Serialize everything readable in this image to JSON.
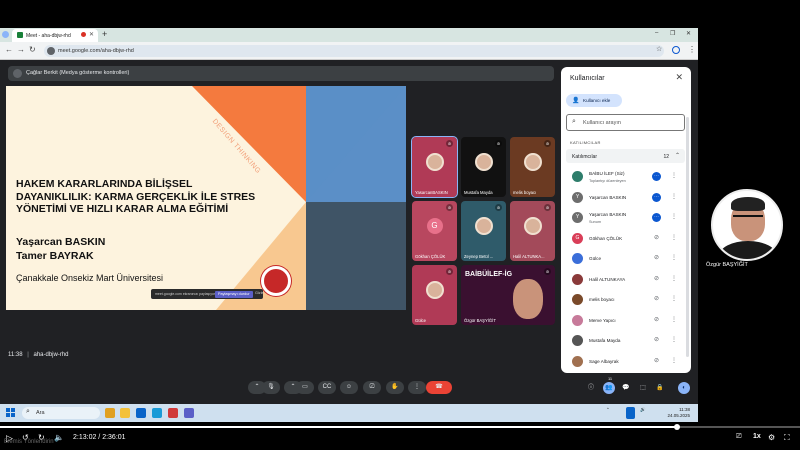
{
  "browser": {
    "tab_title": "Meet - aha-dbjw-rhd",
    "url": "meet.google.com/aha-dbjw-rhd",
    "new_tab_label": "+"
  },
  "meet": {
    "presenter_notice": "Çağlar Berkit (Medya gösterme kontrolleri)",
    "meeting_time": "11:38",
    "meeting_code": "aha-dbjw-rhd",
    "raise_count": "11"
  },
  "slide": {
    "title_lines": [
      "HAKEM KARARLARINDA BİLİŞSEL",
      "DAYANIKLILIK: KARMA GERÇEKLİK İLE STRES",
      "YÖNETİMİ VE HIZLI KARAR ALMA EĞİTİMİ"
    ],
    "author1": "Yaşarcan BASKIN",
    "author2": "Tamer BAYRAK",
    "university": "Çanakkale Onsekiz Mart Üniversitesi",
    "side_text": "DESIGN THINKING",
    "share_text": "meet.google.com ekranınızı paylaşıyor.",
    "share_stop": "Paylaşmayı durdur",
    "share_hide": "Gizle",
    "colors": {
      "bg": "#fdf3de",
      "orange": "#f47a3e",
      "blue": "#5b8fc7",
      "navy": "#3f5466",
      "peach": "#f8c890"
    }
  },
  "tiles": [
    {
      "name": "YasarcanBASKIN",
      "avatar": "",
      "bg": "#b03a56"
    },
    {
      "name": "Mustafa Mayda",
      "avatar": "",
      "bg": "#111111"
    },
    {
      "name": "melis boyacı",
      "avatar": "",
      "bg": "#6b3a22"
    },
    {
      "name": "Gökhan ÇÖLÜK",
      "avatar": "G",
      "bg": "#b8475f"
    },
    {
      "name": "Zeynep Betül ...",
      "avatar": "",
      "bg": "#2f5b6a"
    },
    {
      "name": "Halil ALTUNKA...",
      "avatar": "",
      "bg": "#a34a5a"
    },
    {
      "name": "Gülce",
      "avatar": "",
      "bg": "#b03a56"
    },
    {
      "name": "Özgür BAŞYİĞİT",
      "avatar": "",
      "bg": "#3a1030",
      "brand": "BAİBÜİLEF-İG"
    }
  ],
  "panel": {
    "title": "Kullanıcılar",
    "add_button": "Kullanıcı ekle",
    "search_placeholder": "Kullanıcı arayın",
    "section": "KATILIMCILAR",
    "group": "Katılımcılar",
    "group_count": "12",
    "people": [
      {
        "name": "BAİBU İLEF (Siz)",
        "sub": "Toplantıyı düzenleyen",
        "avatar": "",
        "color": "#2e7d6b",
        "status": "sound"
      },
      {
        "name": "Yaşarcan BASKIN",
        "sub": "",
        "avatar": "Y",
        "color": "#6d6d6d",
        "status": "sound"
      },
      {
        "name": "Yaşarcan BASKIN",
        "sub": "Sunum",
        "avatar": "Y",
        "color": "#6d6d6d",
        "status": "sound"
      },
      {
        "name": "Gökhan ÇÖLÜK",
        "sub": "",
        "avatar": "G",
        "color": "#d93e58",
        "status": "muted"
      },
      {
        "name": "Gülce",
        "sub": "",
        "avatar": "",
        "color": "#3b6ed9",
        "status": "muted"
      },
      {
        "name": "Halil ALTUNKAYA",
        "sub": "",
        "avatar": "",
        "color": "#8a3a3a",
        "status": "muted"
      },
      {
        "name": "melis boyacı",
        "sub": "",
        "avatar": "",
        "color": "#7a4a2a",
        "status": "muted"
      },
      {
        "name": "Merve Yapıcı",
        "sub": "",
        "avatar": "",
        "color": "#c77a9a",
        "status": "muted"
      },
      {
        "name": "Mustafa Mayda",
        "sub": "",
        "avatar": "",
        "color": "#555555",
        "status": "muted"
      },
      {
        "name": "Sage Albayrak",
        "sub": "",
        "avatar": "",
        "color": "#a07050",
        "status": "muted"
      }
    ]
  },
  "webcam": {
    "name": "Özgür BAŞYİĞİT"
  },
  "taskbar": {
    "search": "Ara",
    "time": "11:38",
    "date": "24.05.2025"
  },
  "player": {
    "current": "2:13:02",
    "total": "2:36:01",
    "separator": " / ",
    "speed": "1x",
    "watermark": "Elemis Yönlendirin",
    "progress": 0.8466
  }
}
